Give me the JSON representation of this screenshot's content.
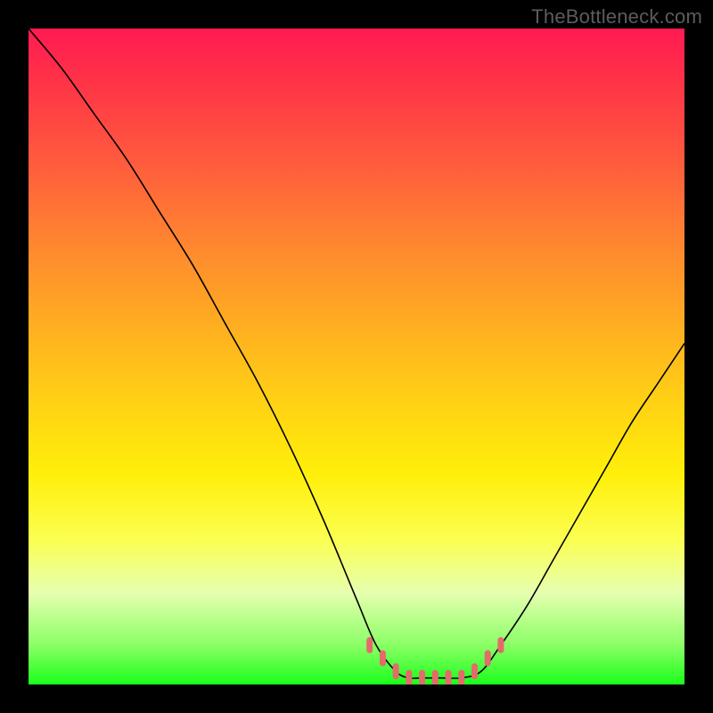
{
  "attribution": "TheBottleneck.com",
  "colors": {
    "background": "#000000",
    "curve_stroke": "#000000",
    "marker_fill": "#e46b6b",
    "gradient_top": "#ff1a52",
    "gradient_bottom": "#1aff1a"
  },
  "chart_data": {
    "type": "line",
    "title": "",
    "xlabel": "",
    "ylabel": "",
    "xlim": [
      0,
      100
    ],
    "ylim": [
      0,
      100
    ],
    "series": [
      {
        "name": "bottleneck-curve",
        "x": [
          0,
          5,
          10,
          15,
          20,
          25,
          30,
          35,
          40,
          45,
          50,
          53,
          56,
          58,
          60,
          63,
          66,
          69,
          72,
          76,
          80,
          84,
          88,
          92,
          96,
          100
        ],
        "y": [
          100,
          94,
          87,
          80,
          72,
          64,
          55,
          46,
          36,
          25,
          13,
          6,
          2,
          1,
          1,
          1,
          1,
          2,
          6,
          12,
          19,
          26,
          33,
          40,
          46,
          52
        ]
      }
    ],
    "markers": {
      "name": "optimal-range-markers",
      "x": [
        52,
        54,
        56,
        58,
        60,
        62,
        64,
        66,
        68,
        70,
        72
      ],
      "y": [
        6,
        4,
        2,
        1,
        1,
        1,
        1,
        1,
        2,
        4,
        6
      ]
    }
  }
}
